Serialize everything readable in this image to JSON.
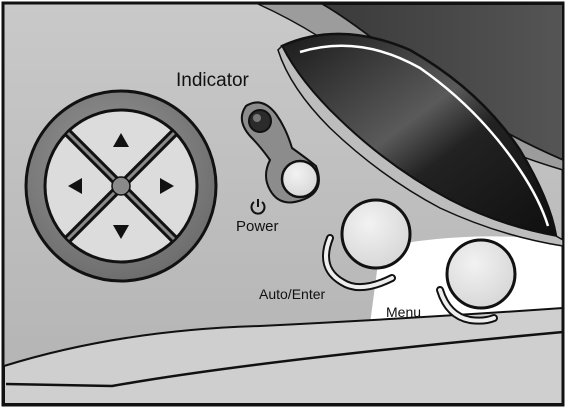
{
  "panel": {
    "indicator_label": "Indicator",
    "power_label": "Power",
    "auto_enter_label": "Auto/Enter",
    "menu_label": "Menu"
  },
  "icons": {
    "power": "power-icon",
    "arrow_up": "arrow-up-icon",
    "arrow_down": "arrow-down-icon",
    "arrow_left": "arrow-left-icon",
    "arrow_right": "arrow-right-icon"
  },
  "colors": {
    "panel_fill": "#bdbdbd",
    "outline": "#111111",
    "button_fill": "#e4e4e4",
    "lens_dark": "#2a2a2a",
    "led": "#555555"
  }
}
